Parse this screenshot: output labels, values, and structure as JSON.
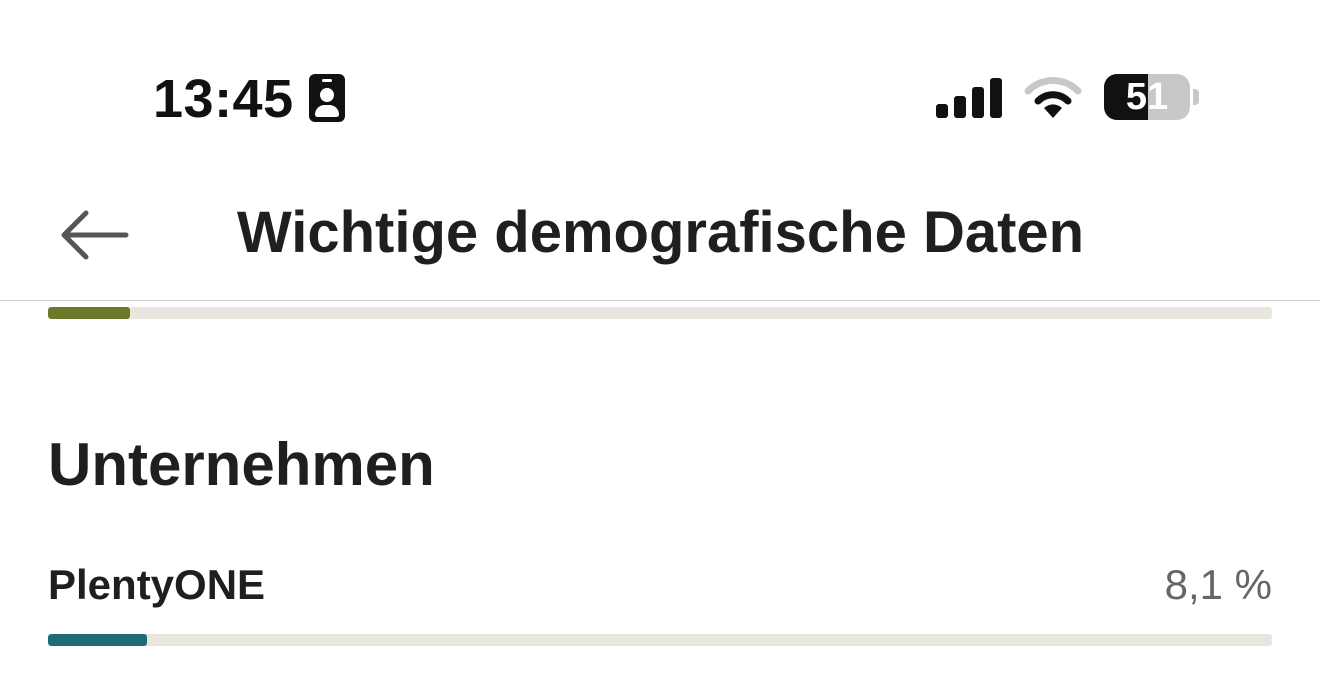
{
  "status_bar": {
    "time": "13:45",
    "battery_level": "51",
    "battery_fraction": 0.51,
    "icons": [
      "id-card-icon",
      "cellular-signal-icon",
      "wifi-icon",
      "battery-icon"
    ]
  },
  "header": {
    "back_icon": "arrow-left-icon",
    "title": "Wichtige demografische Daten"
  },
  "previous_item": {
    "bar_fraction": 0.067,
    "bar_color": "#6b7a2a"
  },
  "section": {
    "title": "Unternehmen",
    "items": [
      {
        "label": "PlentyONE",
        "value": "8,1 %",
        "fraction": 0.081,
        "bar_color": "#1e6b78"
      }
    ]
  },
  "colors": {
    "track": "#e8e6df",
    "text": "#1f1f1f",
    "value_text": "#666666"
  }
}
